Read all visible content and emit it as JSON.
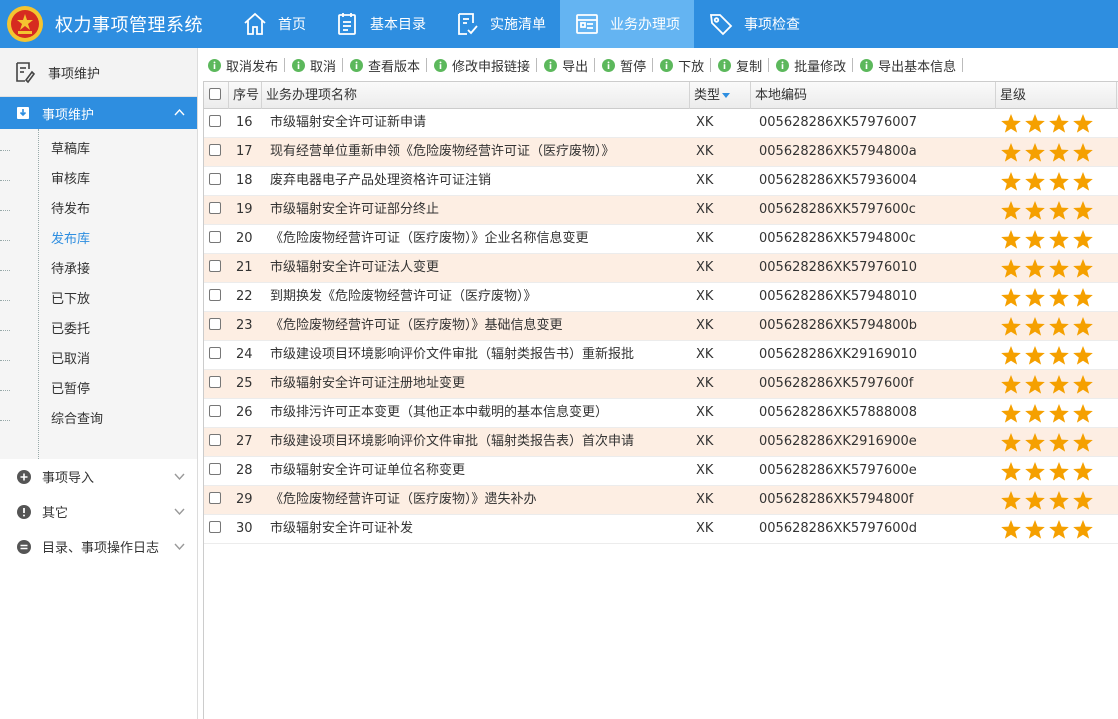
{
  "header": {
    "title": "权力事项管理系统",
    "nav": [
      {
        "label": "首页",
        "icon": "home-icon",
        "active": false
      },
      {
        "label": "基本目录",
        "icon": "catalog-icon",
        "active": false
      },
      {
        "label": "实施清单",
        "icon": "checklist-icon",
        "active": false
      },
      {
        "label": "业务办理项",
        "icon": "business-icon",
        "active": true
      },
      {
        "label": "事项检查",
        "icon": "tag-icon",
        "active": false
      }
    ]
  },
  "sidebar": {
    "top_label": "事项维护",
    "active_section": "事项维护",
    "sub_items": [
      {
        "label": "草稿库",
        "active": false
      },
      {
        "label": "审核库",
        "active": false
      },
      {
        "label": "待发布",
        "active": false
      },
      {
        "label": "发布库",
        "active": true
      },
      {
        "label": "待承接",
        "active": false
      },
      {
        "label": "已下放",
        "active": false
      },
      {
        "label": "已委托",
        "active": false
      },
      {
        "label": "已取消",
        "active": false
      },
      {
        "label": "已暂停",
        "active": false
      },
      {
        "label": "综合查询",
        "active": false
      }
    ],
    "sections": [
      {
        "label": "事项导入",
        "icon": "plus-circle-icon"
      },
      {
        "label": "其它",
        "icon": "exclamation-circle-icon"
      },
      {
        "label": "目录、事项操作日志",
        "icon": "swap-circle-icon"
      }
    ]
  },
  "toolbar": {
    "buttons": [
      "取消发布",
      "取消",
      "查看版本",
      "修改申报链接",
      "导出",
      "暂停",
      "下放",
      "复制",
      "批量修改",
      "导出基本信息"
    ]
  },
  "grid": {
    "columns": {
      "no": "序号",
      "name": "业务办理项名称",
      "type": "类型",
      "code": "本地编码",
      "stars": "星级"
    },
    "rows": [
      {
        "no": "16",
        "name": "市级辐射安全许可证新申请",
        "type": "XK",
        "code": "005628286XK57976007",
        "stars": 4
      },
      {
        "no": "17",
        "name": "现有经营单位重新申领《危险废物经营许可证（医疗废物）》",
        "type": "XK",
        "code": "005628286XK5794800a",
        "stars": 4
      },
      {
        "no": "18",
        "name": "废弃电器电子产品处理资格许可证注销",
        "type": "XK",
        "code": "005628286XK57936004",
        "stars": 4
      },
      {
        "no": "19",
        "name": "市级辐射安全许可证部分终止",
        "type": "XK",
        "code": "005628286XK5797600c",
        "stars": 4
      },
      {
        "no": "20",
        "name": "《危险废物经营许可证（医疗废物）》企业名称信息变更",
        "type": "XK",
        "code": "005628286XK5794800c",
        "stars": 4
      },
      {
        "no": "21",
        "name": "市级辐射安全许可证法人变更",
        "type": "XK",
        "code": "005628286XK57976010",
        "stars": 4
      },
      {
        "no": "22",
        "name": "到期换发《危险废物经营许可证（医疗废物）》",
        "type": "XK",
        "code": "005628286XK57948010",
        "stars": 4
      },
      {
        "no": "23",
        "name": "《危险废物经营许可证（医疗废物）》基础信息变更",
        "type": "XK",
        "code": "005628286XK5794800b",
        "stars": 4
      },
      {
        "no": "24",
        "name": "市级建设项目环境影响评价文件审批（辐射类报告书）重新报批",
        "type": "XK",
        "code": "005628286XK29169010",
        "stars": 4
      },
      {
        "no": "25",
        "name": "市级辐射安全许可证注册地址变更",
        "type": "XK",
        "code": "005628286XK5797600f",
        "stars": 4
      },
      {
        "no": "26",
        "name": "市级排污许可正本变更（其他正本中载明的基本信息变更）",
        "type": "XK",
        "code": "005628286XK57888008",
        "stars": 4
      },
      {
        "no": "27",
        "name": "市级建设项目环境影响评价文件审批（辐射类报告表）首次申请",
        "type": "XK",
        "code": "005628286XK2916900e",
        "stars": 4
      },
      {
        "no": "28",
        "name": "市级辐射安全许可证单位名称变更",
        "type": "XK",
        "code": "005628286XK5797600e",
        "stars": 4
      },
      {
        "no": "29",
        "name": "《危险废物经营许可证（医疗废物）》遗失补办",
        "type": "XK",
        "code": "005628286XK5794800f",
        "stars": 4
      },
      {
        "no": "30",
        "name": "市级辐射安全许可证补发",
        "type": "XK",
        "code": "005628286XK5797600d",
        "stars": 4
      }
    ]
  },
  "colors": {
    "primary": "#2e8ee0",
    "nav_active": "#64b4f2",
    "row_alt": "#fdeee3",
    "star": "#f5a000",
    "toolbar_icon": "#5cb85c"
  }
}
